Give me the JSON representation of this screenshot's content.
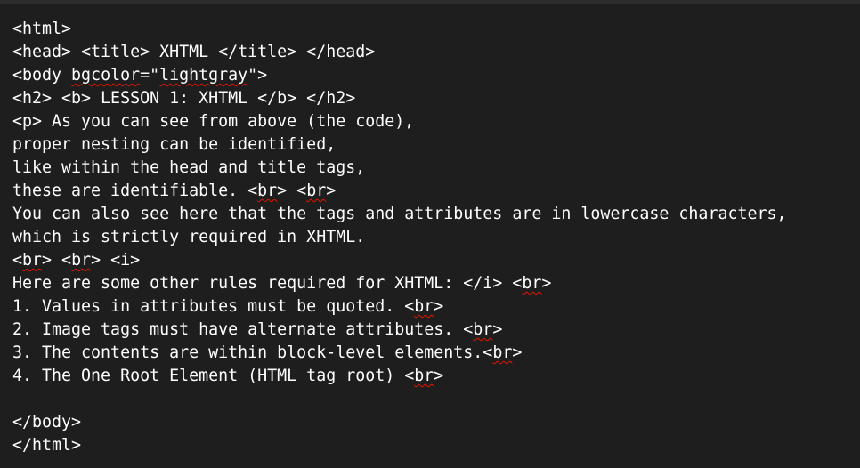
{
  "editor": {
    "lines": [
      [
        {
          "t": "<html>"
        }
      ],
      [
        {
          "t": "<head> <title> XHTML </title> </head>"
        }
      ],
      [
        {
          "t": "<body "
        },
        {
          "t": "bgcolor",
          "sq": true
        },
        {
          "t": "=\""
        },
        {
          "t": "lightgray",
          "sq": true
        },
        {
          "t": "\">"
        }
      ],
      [
        {
          "t": "<h2> <b> LESSON 1: XHTML </b> </h2>"
        }
      ],
      [
        {
          "t": "<p> As you can see from above (the code),"
        }
      ],
      [
        {
          "t": "proper nesting can be identified,"
        }
      ],
      [
        {
          "t": "like within the head and title tags,"
        }
      ],
      [
        {
          "t": "these are identifiable. <"
        },
        {
          "t": "br",
          "sq": true
        },
        {
          "t": "> <"
        },
        {
          "t": "br",
          "sq": true
        },
        {
          "t": ">"
        }
      ],
      [
        {
          "t": "You can also see here that the tags and attributes are in lowercase characters,"
        }
      ],
      [
        {
          "t": "which is strictly required in XHTML."
        }
      ],
      [
        {
          "t": "<"
        },
        {
          "t": "br",
          "sq": true
        },
        {
          "t": "> <"
        },
        {
          "t": "br",
          "sq": true
        },
        {
          "t": "> <i>"
        }
      ],
      [
        {
          "t": "Here are some other rules required for XHTML: </i> <"
        },
        {
          "t": "br",
          "sq": true
        },
        {
          "t": ">"
        }
      ],
      [
        {
          "t": "1. Values in attributes must be quoted. <"
        },
        {
          "t": "br",
          "sq": true
        },
        {
          "t": ">"
        }
      ],
      [
        {
          "t": "2. Image tags must have alternate attributes. <"
        },
        {
          "t": "br",
          "sq": true
        },
        {
          "t": ">"
        }
      ],
      [
        {
          "t": "3. The contents are within block-level elements.<"
        },
        {
          "t": "br",
          "sq": true
        },
        {
          "t": ">"
        }
      ],
      [
        {
          "t": "4. The One Root Element (HTML tag root) <"
        },
        {
          "t": "br",
          "sq": true
        },
        {
          "t": ">"
        }
      ],
      [
        {
          "t": ""
        }
      ],
      [
        {
          "t": "</body>"
        }
      ],
      [
        {
          "t": "</html>"
        }
      ]
    ]
  },
  "colors": {
    "background": "#1e1e1e",
    "text": "#ffffff",
    "squiggle": "#e51400"
  }
}
